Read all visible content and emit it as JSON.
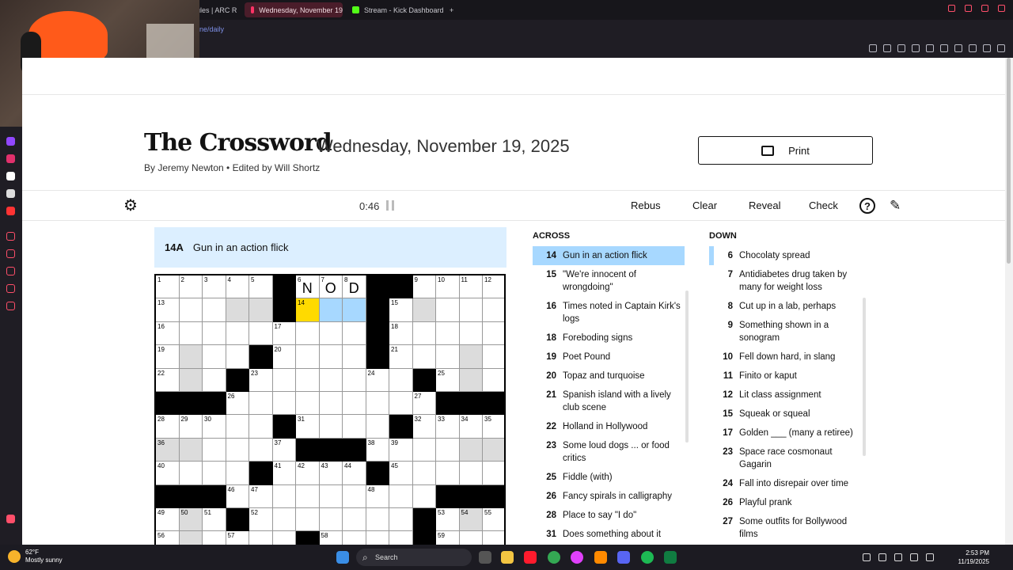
{
  "browser": {
    "tabs": [
      {
        "label": "ules | ARC R"
      },
      {
        "label": "Wednesday, November 19"
      },
      {
        "label": "Stream - Kick Dashboard"
      }
    ],
    "new_tab": "+",
    "url": "ne/daily"
  },
  "header": {
    "title": "The Crossword",
    "date": "Wednesday, November 19, 2025",
    "byline": "By Jeremy Newton  •  Edited by Will Shortz",
    "print_label": "Print"
  },
  "toolbar": {
    "timer": "0:46",
    "rebus": "Rebus",
    "clear": "Clear",
    "reveal": "Reveal",
    "check": "Check",
    "help": "?"
  },
  "active_clue": {
    "number": "14A",
    "text": "Gun in an action flick"
  },
  "grid": {
    "rows": [
      "....##...##...",
      ".....#....#...",
      "..........#...",
      "..........#...",
      "..........#...",
      "..........#...",
      "..........#...",
      "..........#...",
      "..........#...",
      "..........#...",
      "..........#...",
      "..........#..."
    ],
    "cells": [
      [
        [
          "1"
        ],
        [
          "2"
        ],
        [
          "3"
        ],
        [
          "4"
        ],
        [
          "5"
        ],
        [
          null,
          "b"
        ],
        [
          "6",
          "N"
        ],
        [
          "7",
          "O"
        ],
        [
          "8",
          "D"
        ],
        [
          null,
          "b"
        ],
        [
          null,
          "b"
        ],
        [
          "9"
        ],
        [
          "10"
        ],
        [
          "11"
        ],
        [
          "12"
        ]
      ],
      [
        [
          "13"
        ],
        [
          ""
        ],
        [
          ""
        ],
        [
          "",
          "g"
        ],
        [
          "",
          "g"
        ],
        [
          null,
          "b"
        ],
        [
          "14",
          "",
          "c"
        ],
        [
          "",
          "",
          "h"
        ],
        [
          "",
          "",
          "h"
        ],
        [
          null,
          "b"
        ],
        [
          "15"
        ],
        [
          "",
          "g"
        ],
        [
          ""
        ],
        [
          ""
        ],
        [
          ""
        ]
      ],
      [
        [
          "16"
        ],
        [
          ""
        ],
        [
          ""
        ],
        [
          ""
        ],
        [
          ""
        ],
        [
          "17"
        ],
        [
          ""
        ],
        [
          ""
        ],
        [
          ""
        ],
        [
          null,
          "b"
        ],
        [
          "18"
        ],
        [
          ""
        ],
        [
          ""
        ],
        [
          ""
        ],
        [
          ""
        ]
      ],
      [
        [
          "19"
        ],
        [
          "",
          "g"
        ],
        [
          ""
        ],
        [
          ""
        ],
        [
          null,
          "b"
        ],
        [
          "20"
        ],
        [
          ""
        ],
        [
          ""
        ],
        [
          ""
        ],
        [
          null,
          "b"
        ],
        [
          "21"
        ],
        [
          ""
        ],
        [
          ""
        ],
        [
          "",
          "g"
        ],
        [
          ""
        ]
      ],
      [
        [
          "22"
        ],
        [
          "",
          "g"
        ],
        [
          ""
        ],
        [
          null,
          "b"
        ],
        [
          "23"
        ],
        [
          ""
        ],
        [
          ""
        ],
        [
          ""
        ],
        [
          ""
        ],
        [
          "24"
        ],
        [
          ""
        ],
        [
          null,
          "b"
        ],
        [
          "25"
        ],
        [
          "",
          "g"
        ],
        [
          ""
        ]
      ],
      [
        [
          null,
          "b"
        ],
        [
          null,
          "b"
        ],
        [
          null,
          "b"
        ],
        [
          "26"
        ],
        [
          ""
        ],
        [
          ""
        ],
        [
          ""
        ],
        [
          ""
        ],
        [
          ""
        ],
        [
          ""
        ],
        [
          ""
        ],
        [
          "27"
        ],
        [
          null,
          "b"
        ],
        [
          null,
          "b"
        ],
        [
          null,
          "b"
        ]
      ],
      [
        [
          "28"
        ],
        [
          "29"
        ],
        [
          "30"
        ],
        [
          ""
        ],
        [
          ""
        ],
        [
          null,
          "b"
        ],
        [
          "31"
        ],
        [
          ""
        ],
        [
          ""
        ],
        [
          ""
        ],
        [
          null,
          "b"
        ],
        [
          "32"
        ],
        [
          "33"
        ],
        [
          "34"
        ],
        [
          "35"
        ]
      ],
      [
        [
          "36",
          "",
          "g"
        ],
        [
          "",
          "g"
        ],
        [
          ""
        ],
        [
          ""
        ],
        [
          ""
        ],
        [
          "37"
        ],
        [
          null,
          "b"
        ],
        [
          null,
          "b"
        ],
        [
          null,
          "b"
        ],
        [
          "38"
        ],
        [
          "39"
        ],
        [
          ""
        ],
        [
          ""
        ],
        [
          "",
          "g"
        ],
        [
          "",
          "g"
        ]
      ],
      [
        [
          "40"
        ],
        [
          ""
        ],
        [
          ""
        ],
        [
          ""
        ],
        [
          null,
          "b"
        ],
        [
          "41"
        ],
        [
          "42"
        ],
        [
          "43"
        ],
        [
          "44"
        ],
        [
          null,
          "b"
        ],
        [
          "45"
        ],
        [
          ""
        ],
        [
          ""
        ],
        [
          ""
        ],
        [
          ""
        ]
      ],
      [
        [
          null,
          "b"
        ],
        [
          null,
          "b"
        ],
        [
          null,
          "b"
        ],
        [
          "46"
        ],
        [
          "47"
        ],
        [
          ""
        ],
        [
          ""
        ],
        [
          ""
        ],
        [
          ""
        ],
        [
          "48"
        ],
        [
          ""
        ],
        [
          ""
        ],
        [
          null,
          "b"
        ],
        [
          null,
          "b"
        ],
        [
          null,
          "b"
        ]
      ],
      [
        [
          "49"
        ],
        [
          "50",
          "",
          "g"
        ],
        [
          "51"
        ],
        [
          null,
          "b"
        ],
        [
          "52"
        ],
        [
          ""
        ],
        [
          ""
        ],
        [
          ""
        ],
        [
          ""
        ],
        [
          ""
        ],
        [
          ""
        ],
        [
          null,
          "b"
        ],
        [
          "53"
        ],
        [
          "54",
          "",
          "g"
        ],
        [
          "55"
        ]
      ],
      [
        [
          "56"
        ],
        [
          "",
          "g"
        ],
        [
          ""
        ],
        [
          "57"
        ],
        [
          ""
        ],
        [
          ""
        ],
        [
          null,
          "b"
        ],
        [
          "58"
        ],
        [
          ""
        ],
        [
          ""
        ],
        [
          ""
        ],
        [
          null,
          "b"
        ],
        [
          "59"
        ],
        [
          ""
        ],
        [
          ""
        ]
      ]
    ]
  },
  "across": {
    "heading": "ACROSS",
    "clues": [
      {
        "n": "14",
        "t": "Gun in an action flick"
      },
      {
        "n": "15",
        "t": "\"We're innocent of wrongdoing\""
      },
      {
        "n": "16",
        "t": "Times noted in Captain Kirk's logs"
      },
      {
        "n": "18",
        "t": "Foreboding signs"
      },
      {
        "n": "19",
        "t": "Poet Pound"
      },
      {
        "n": "20",
        "t": "Topaz and turquoise"
      },
      {
        "n": "21",
        "t": "Spanish island with a lively club scene"
      },
      {
        "n": "22",
        "t": "Holland in Hollywood"
      },
      {
        "n": "23",
        "t": "Some loud dogs ... or food critics"
      },
      {
        "n": "25",
        "t": "Fiddle (with)"
      },
      {
        "n": "26",
        "t": "Fancy spirals in calligraphy"
      },
      {
        "n": "28",
        "t": "Place to say \"I do\""
      },
      {
        "n": "31",
        "t": "Does something about it"
      }
    ]
  },
  "down": {
    "heading": "DOWN",
    "clues": [
      {
        "n": "6",
        "t": "Chocolaty spread"
      },
      {
        "n": "7",
        "t": "Antidiabetes drug taken by many for weight loss"
      },
      {
        "n": "8",
        "t": "Cut up in a lab, perhaps"
      },
      {
        "n": "9",
        "t": "Something shown in a sonogram"
      },
      {
        "n": "10",
        "t": "Fell down hard, in slang"
      },
      {
        "n": "11",
        "t": "Finito or kaput"
      },
      {
        "n": "12",
        "t": "Lit class assignment"
      },
      {
        "n": "15",
        "t": "Squeak or squeal"
      },
      {
        "n": "17",
        "t": "Golden ___ (many a retiree)"
      },
      {
        "n": "23",
        "t": "Space race cosmonaut Gagarin"
      },
      {
        "n": "24",
        "t": "Fall into disrepair over time"
      },
      {
        "n": "26",
        "t": "Playful prank"
      },
      {
        "n": "27",
        "t": "Some outfits for Bollywood films"
      }
    ]
  },
  "taskbar": {
    "temp": "62°F",
    "weather": "Mostly sunny",
    "search": "Search",
    "time": "2:53 PM",
    "date": "11/19/2025"
  }
}
